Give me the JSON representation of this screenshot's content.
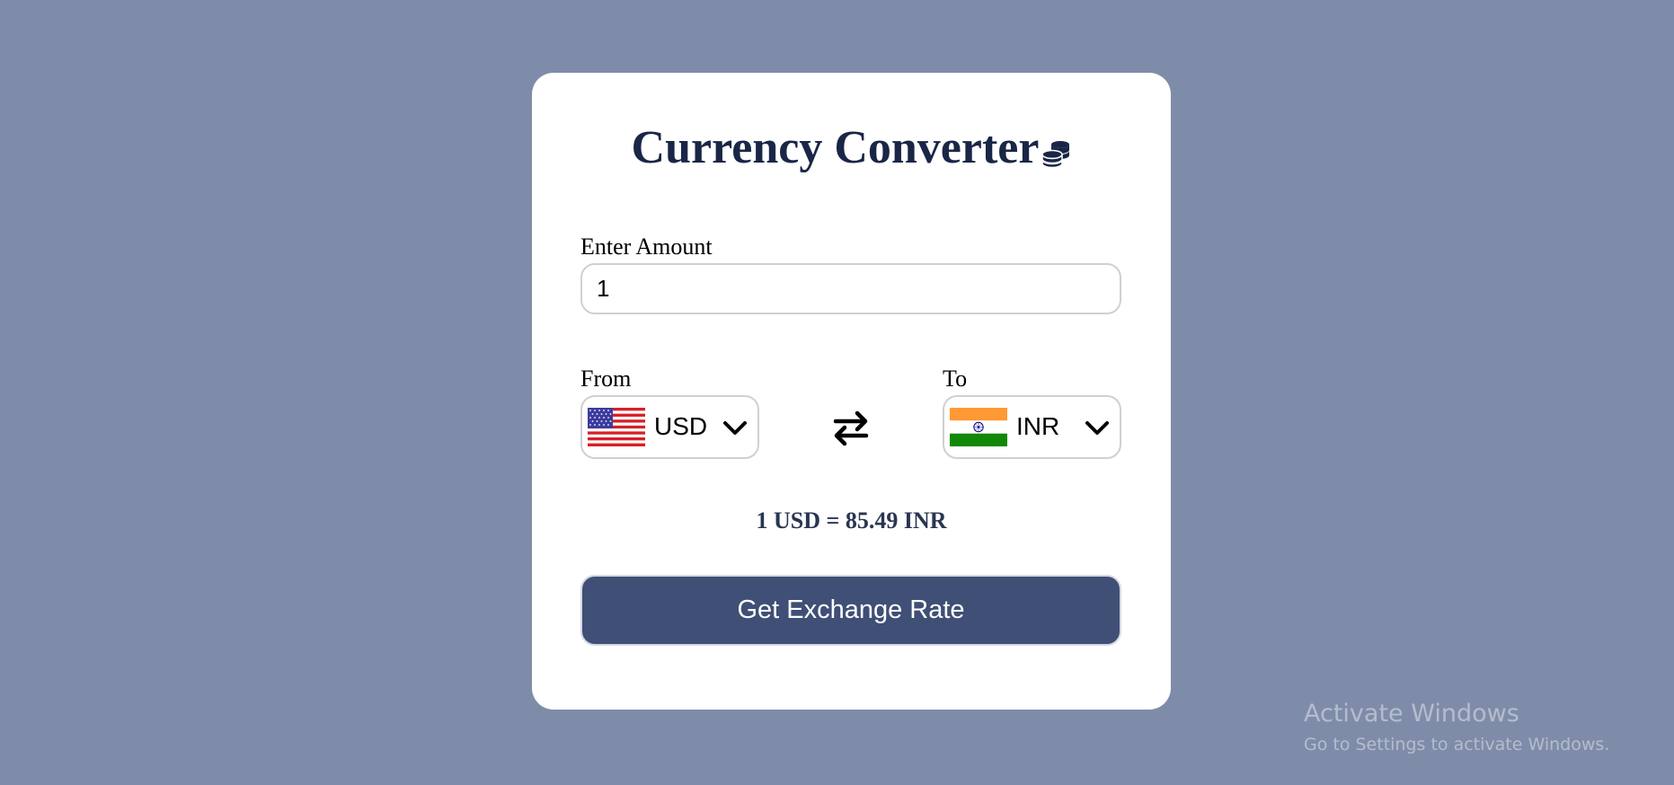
{
  "converter": {
    "title": "Currency Converter",
    "title_icon": "coins-icon",
    "amount_label": "Enter Amount",
    "amount_value": "1",
    "from_label": "From",
    "from_currency": "USD",
    "from_flag": "us-flag-icon",
    "to_label": "To",
    "to_currency": "INR",
    "to_flag": "india-flag-icon",
    "swap_icon": "swap-arrows-icon",
    "rate_text": "1 USD = 85.49 INR",
    "button_label": "Get Exchange Rate"
  },
  "watermark": {
    "title": "Activate Windows",
    "subtitle": "Go to Settings to activate Windows."
  },
  "colors": {
    "background": "#7f8ca9",
    "card": "#ffffff",
    "title": "#1a2646",
    "button": "#3f4f76",
    "rate_text": "#2a3552"
  }
}
